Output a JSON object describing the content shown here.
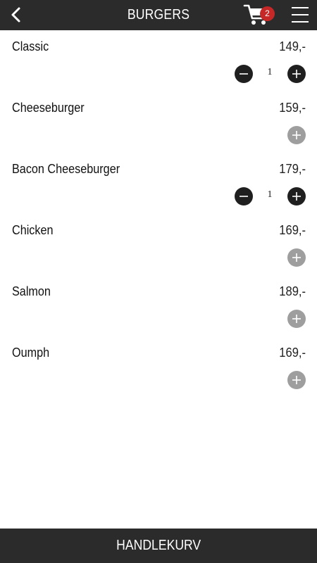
{
  "header": {
    "title": "BURGERS",
    "back_icon": "chevron-left-icon",
    "cart_icon": "shopping-cart-icon",
    "cart_count": "2",
    "menu_icon": "hamburger-menu-icon",
    "background": "#2b2b2b",
    "badge_color": "#c62828"
  },
  "items": [
    {
      "name": "Classic",
      "price": "149,-",
      "qty": "1"
    },
    {
      "name": "Cheeseburger",
      "price": "159,-",
      "qty": ""
    },
    {
      "name": "Bacon Cheeseburger",
      "price": "179,-",
      "qty": "1"
    },
    {
      "name": "Chicken",
      "price": "169,-",
      "qty": ""
    },
    {
      "name": "Salmon",
      "price": "189,-",
      "qty": ""
    },
    {
      "name": "Oumph",
      "price": "169,-",
      "qty": ""
    }
  ],
  "footer": {
    "label": "HANDLEKURV"
  }
}
